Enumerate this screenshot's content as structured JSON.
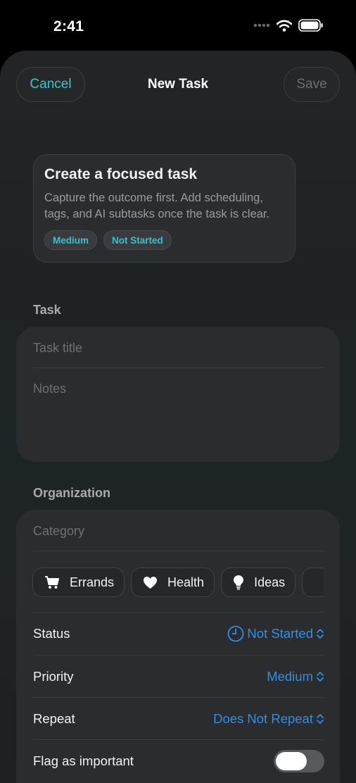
{
  "status_bar": {
    "time": "2:41"
  },
  "nav": {
    "cancel_label": "Cancel",
    "title": "New Task",
    "save_label": "Save"
  },
  "intro": {
    "title": "Create a focused task",
    "description": "Capture the outcome first. Add scheduling, tags, and AI subtasks once the task is clear.",
    "badges": [
      "Medium",
      "Not Started"
    ]
  },
  "task_section": {
    "label": "Task",
    "title_placeholder": "Task title",
    "notes_placeholder": "Notes"
  },
  "organization": {
    "label": "Organization",
    "category_placeholder": "Category",
    "categories": [
      {
        "label": "Errands",
        "icon": "cart-icon"
      },
      {
        "label": "Health",
        "icon": "heart-icon"
      },
      {
        "label": "Ideas",
        "icon": "lightbulb-icon"
      }
    ],
    "status": {
      "label": "Status",
      "value": "Not Started",
      "icon": "clock-icon"
    },
    "priority": {
      "label": "Priority",
      "value": "Medium"
    },
    "repeat": {
      "label": "Repeat",
      "value": "Does Not Repeat"
    },
    "flag": {
      "label": "Flag as important",
      "on": false
    }
  },
  "colors": {
    "accent_teal": "#37c7cf",
    "link_blue": "#2f8fe6"
  }
}
